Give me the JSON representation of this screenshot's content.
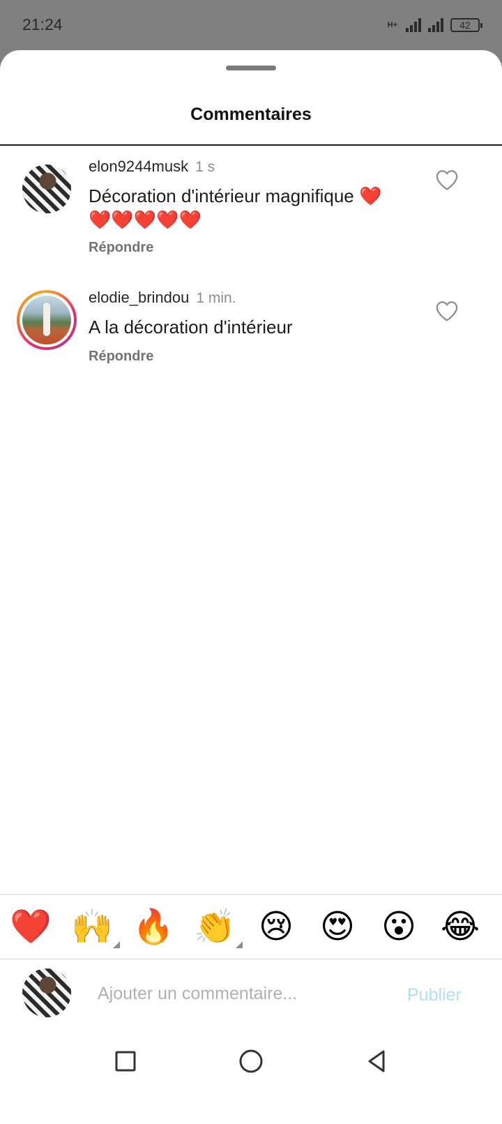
{
  "status": {
    "time": "21:24",
    "network": "H+",
    "battery": "42"
  },
  "sheet": {
    "title": "Commentaires"
  },
  "comments": [
    {
      "username": "elon9244musk",
      "time": "1 s",
      "text_line1": "Décoration d'intérieur magnifique ❤️",
      "text_line2": "❤️❤️❤️❤️❤️",
      "reply_label": "Répondre"
    },
    {
      "username": "elodie_brindou",
      "time": "1 min.",
      "text_line1": "A la décoration d'intérieur",
      "reply_label": "Répondre"
    }
  ],
  "emoji_bar": {
    "emojis": [
      "❤️",
      "🙌",
      "🔥",
      "👏",
      "😢",
      "😍",
      "😮",
      "😂"
    ]
  },
  "composer": {
    "placeholder": "Ajouter un commentaire...",
    "publish_label": "Publier",
    "publish_color": "#b3dbff"
  },
  "icons": {
    "like": "heart-outline-icon",
    "nav_recent": "square-icon",
    "nav_home": "circle-icon",
    "nav_back": "triangle-back-icon"
  }
}
